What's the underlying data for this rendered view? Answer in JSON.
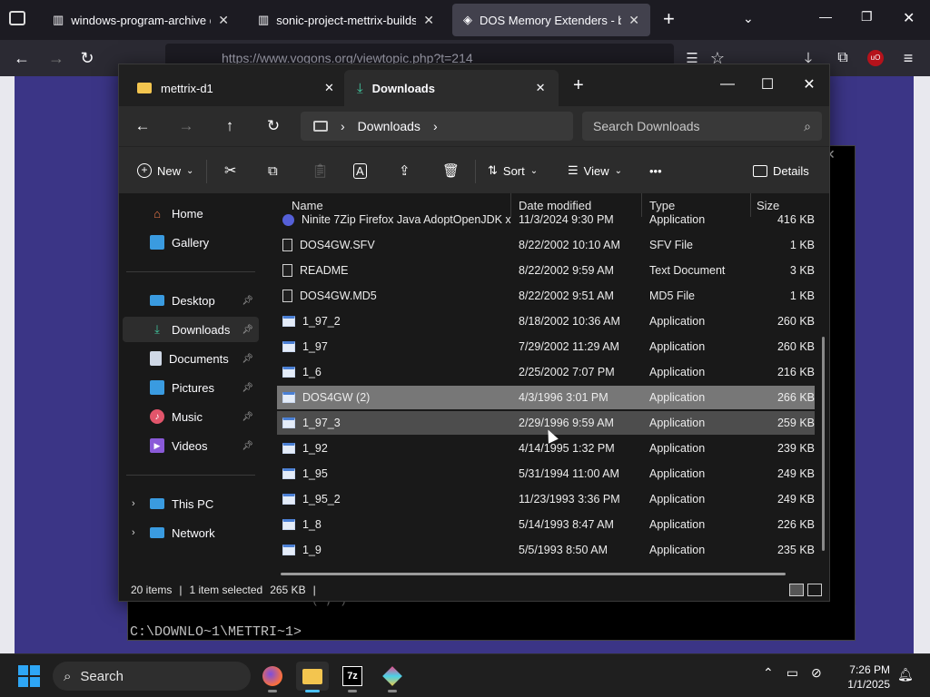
{
  "browser": {
    "tabs": [
      {
        "label": "windows-program-archive dire",
        "active": false
      },
      {
        "label": "sonic-project-mettrix-builds di",
        "active": false
      },
      {
        "label": "DOS Memory Extenders - by Sn",
        "active": true
      }
    ],
    "new_tab": "+",
    "url": "https://www.vogons.org/viewtopic.php?t=214",
    "colors": {
      "bg": "#1c1b22",
      "toolbar": "#2b2a33",
      "page_bg": "#3b3586"
    }
  },
  "dos": {
    "prompt": "C:\\DOWNLO~1\\METTRI~1>",
    "cut_text": "( ,  )"
  },
  "explorer": {
    "tabs": [
      {
        "label": "mettrix-d1",
        "icon": "folder-icon"
      },
      {
        "label": "Downloads",
        "icon": "download-icon"
      }
    ],
    "breadcrumb": {
      "location": "Downloads"
    },
    "search_placeholder": "Search Downloads",
    "commands": {
      "new": "New",
      "sort": "Sort",
      "view": "View",
      "more": "•••",
      "details": "Details"
    },
    "nav": {
      "home": "Home",
      "gallery": "Gallery",
      "desktop": "Desktop",
      "downloads": "Downloads",
      "documents": "Documents",
      "pictures": "Pictures",
      "music": "Music",
      "videos": "Videos",
      "this_pc": "This PC",
      "network": "Network"
    },
    "columns": {
      "name": "Name",
      "date": "Date modified",
      "type": "Type",
      "size": "Size"
    },
    "files": [
      {
        "name": "Ninite 7Zip Firefox Java AdoptOpenJDK x...",
        "date": "11/3/2024 9:30 PM",
        "type": "Application",
        "size": "416 KB",
        "icon": "installer"
      },
      {
        "name": "DOS4GW.SFV",
        "date": "8/22/2002 10:10 AM",
        "type": "SFV File",
        "size": "1 KB",
        "icon": "doc"
      },
      {
        "name": "README",
        "date": "8/22/2002 9:59 AM",
        "type": "Text Document",
        "size": "3 KB",
        "icon": "doc"
      },
      {
        "name": "DOS4GW.MD5",
        "date": "8/22/2002 9:51 AM",
        "type": "MD5 File",
        "size": "1 KB",
        "icon": "doc"
      },
      {
        "name": "1_97_2",
        "date": "8/18/2002 10:36 AM",
        "type": "Application",
        "size": "260 KB",
        "icon": "app"
      },
      {
        "name": "1_97",
        "date": "7/29/2002 11:29 AM",
        "type": "Application",
        "size": "260 KB",
        "icon": "app"
      },
      {
        "name": "1_6",
        "date": "2/25/2002 7:07 PM",
        "type": "Application",
        "size": "216 KB",
        "icon": "app"
      },
      {
        "name": "DOS4GW (2)",
        "date": "4/3/1996 3:01 PM",
        "type": "Application",
        "size": "266 KB",
        "icon": "app",
        "state": "selected"
      },
      {
        "name": "1_97_3",
        "date": "2/29/1996 9:59 AM",
        "type": "Application",
        "size": "259 KB",
        "icon": "app",
        "state": "hover"
      },
      {
        "name": "1_92",
        "date": "4/14/1995 1:32 PM",
        "type": "Application",
        "size": "239 KB",
        "icon": "app"
      },
      {
        "name": "1_95",
        "date": "5/31/1994 11:00 AM",
        "type": "Application",
        "size": "249 KB",
        "icon": "app"
      },
      {
        "name": "1_95_2",
        "date": "11/23/1993 3:36 PM",
        "type": "Application",
        "size": "249 KB",
        "icon": "app"
      },
      {
        "name": "1_8",
        "date": "5/14/1993 8:47 AM",
        "type": "Application",
        "size": "226 KB",
        "icon": "app"
      },
      {
        "name": "1_9",
        "date": "5/5/1993 8:50 AM",
        "type": "Application",
        "size": "235 KB",
        "icon": "app"
      }
    ],
    "status": {
      "count": "20 items",
      "sep": "|",
      "selected": "1 item selected",
      "size": "265 KB"
    }
  },
  "taskbar": {
    "search": "Search",
    "apps": [
      {
        "label": "",
        "icon": "firefox-icon"
      },
      {
        "label": "",
        "icon": "file-explorer-icon"
      },
      {
        "label": "7z",
        "icon": "7zip-icon"
      },
      {
        "label": "",
        "icon": "app-icon"
      }
    ],
    "time": "7:26 PM",
    "date": "1/1/2025"
  }
}
